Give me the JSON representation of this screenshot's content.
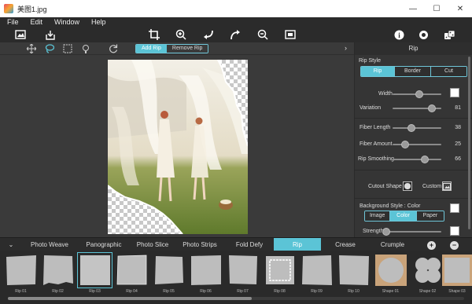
{
  "window": {
    "title": "美图1.jpg",
    "minimize": "—",
    "maximize": "☐",
    "close": "✕"
  },
  "menu": [
    "File",
    "Edit",
    "Window",
    "Help"
  ],
  "toolbar": {
    "icons": [
      "open-image-icon",
      "save-icon",
      "crop-icon",
      "zoom-in-icon",
      "undo-icon",
      "redo-icon",
      "zoom-out-icon",
      "fit-screen-icon",
      "info-icon",
      "settings-icon",
      "dice-icon"
    ]
  },
  "subtoolbar": {
    "icons": [
      "move-icon",
      "lasso-icon",
      "rect-select-icon",
      "brush-icon",
      "refresh-icon"
    ],
    "add_rip": "Add Rip",
    "remove_rip": "Remove Rip",
    "panel_arrow": "›"
  },
  "panel": {
    "header": "Rip",
    "rip_style_title": "Rip Style",
    "rip_style_options": [
      "Rip",
      "Border",
      "Cut"
    ],
    "rip_style_active": "Rip",
    "width_label": "Width",
    "variation_label": "Variation",
    "variation_value": "81",
    "fiber_length_label": "Fiber Length",
    "fiber_length_value": "38",
    "fiber_amount_label": "Fiber Amount",
    "fiber_amount_value": "25",
    "rip_smoothing_label": "Rip Smoothing",
    "rip_smoothing_value": "66",
    "cutout_shape_label": "Cutout Shape",
    "custom_label": "Custom",
    "bg_style_title": "Background Style : Color",
    "bg_style_options": [
      "Image",
      "Color",
      "Paper"
    ],
    "bg_style_active": "Color",
    "strength_label": "Strength",
    "slider_levels": {
      "width": 0.55,
      "variation": 0.81,
      "fiber_length": 0.38,
      "fiber_amount": 0.25,
      "rip_smoothing": 0.66,
      "strength": 0.0
    },
    "swatch_color": "#ffffff"
  },
  "tabs": {
    "items": [
      "Photo Weave",
      "Panographic",
      "Photo Slice",
      "Photo Strips",
      "Fold Defy",
      "Rip",
      "Crease",
      "Crumple"
    ],
    "active": "Rip",
    "collapse": "⌄",
    "add": "+",
    "remove": "−"
  },
  "thumbnails": [
    {
      "label": "Rip 01"
    },
    {
      "label": "Rip 02"
    },
    {
      "label": "Rip 03"
    },
    {
      "label": "Rip 04"
    },
    {
      "label": "Rip 05"
    },
    {
      "label": "Rip 06"
    },
    {
      "label": "Rip 07"
    },
    {
      "label": "Rip 08"
    },
    {
      "label": "Rip 09"
    },
    {
      "label": "Rip 10"
    },
    {
      "label": "Shape 01"
    },
    {
      "label": "Shape 02"
    },
    {
      "label": "Shape 03"
    }
  ],
  "selected_thumbnail": "Rip 03",
  "colors": {
    "accent": "#5bc4d6",
    "background": "#3a3a3a",
    "toolbar": "#2b2b2b"
  }
}
